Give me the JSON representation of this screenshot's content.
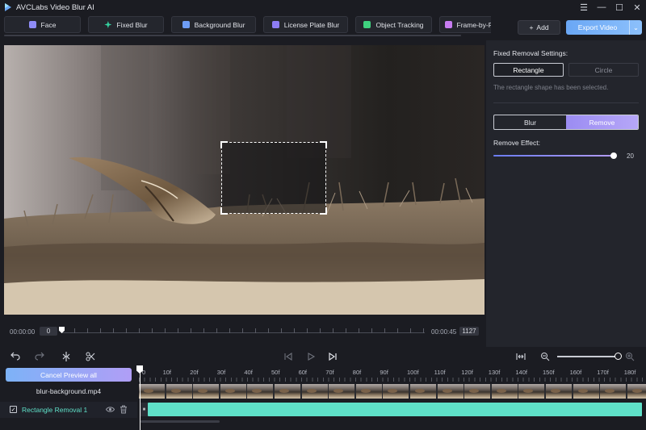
{
  "app": {
    "title": "AVCLabs Video Blur AI"
  },
  "tabs": [
    {
      "label": "Face",
      "icon": "face-icon",
      "color": "#8f8cf7"
    },
    {
      "label": "Fixed Blur",
      "icon": "sparkle-icon",
      "color": "#35d1a0"
    },
    {
      "label": "Background Blur",
      "icon": "background-icon",
      "color": "#6e9df5"
    },
    {
      "label": "License Plate Blur",
      "icon": "car-icon",
      "color": "#8d7cf4"
    },
    {
      "label": "Object Tracking",
      "icon": "tracking-icon",
      "color": "#3fd27f"
    },
    {
      "label": "Frame-by-Fra",
      "icon": "frame-icon",
      "color": "#c77cf1"
    }
  ],
  "toolbar": {
    "add_label": "Add",
    "export_label": "Export Video"
  },
  "player": {
    "start_time": "00:00:00",
    "start_frame": "0",
    "end_time": "00:00:45",
    "end_frame": "1127"
  },
  "panel": {
    "title": "Fixed Removal Settings:",
    "shapes": [
      "Rectangle",
      "Circle"
    ],
    "active_shape": "Rectangle",
    "note": "The rectangle shape has been selected.",
    "modes": [
      "Blur",
      "Remove"
    ],
    "active_mode": "Remove",
    "effect_label": "Remove Effect:",
    "effect_value": "20",
    "effect_fraction": 0.98
  },
  "timeline": {
    "cancel_label": "Cancel Preview all",
    "file_name": "blur-background.mp4",
    "track_label": "Rectangle Removal 1",
    "ticks": [
      "0",
      "10f",
      "20f",
      "30f",
      "40f",
      "50f",
      "60f",
      "70f",
      "80f",
      "90f",
      "100f",
      "110f",
      "120f",
      "130f",
      "140f",
      "150f",
      "160f",
      "170f",
      "180f"
    ]
  }
}
